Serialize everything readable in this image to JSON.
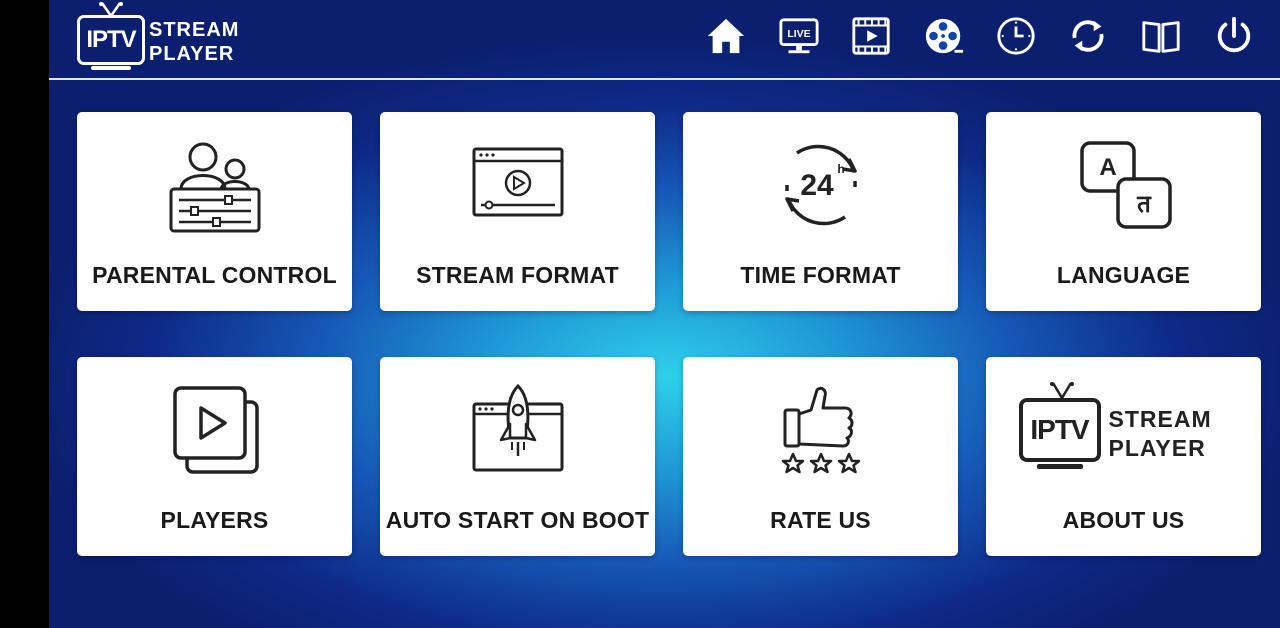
{
  "app": {
    "logo_badge": "IPTV",
    "logo_line1": "STREAM",
    "logo_line2": "PLAYER"
  },
  "nav": [
    {
      "icon": "home-icon"
    },
    {
      "icon": "live-tv-icon",
      "badge": "LIVE"
    },
    {
      "icon": "movies-icon"
    },
    {
      "icon": "film-reel-icon"
    },
    {
      "icon": "clock-icon"
    },
    {
      "icon": "refresh-icon"
    },
    {
      "icon": "book-icon"
    },
    {
      "icon": "power-icon"
    }
  ],
  "tiles": {
    "parental_control": {
      "label": "PARENTAL CONTROL",
      "icon": "parental-control-icon"
    },
    "stream_format": {
      "label": "STREAM FORMAT",
      "icon": "stream-format-icon"
    },
    "time_format": {
      "label": "TIME FORMAT",
      "icon": "time-format-icon",
      "icon_text": "24",
      "icon_sup": "h"
    },
    "language": {
      "label": "LANGUAGE",
      "icon": "language-icon",
      "glyph_a": "A",
      "glyph_b": "त"
    },
    "players": {
      "label": "PLAYERS",
      "icon": "players-icon"
    },
    "auto_start": {
      "label": "AUTO START ON BOOT",
      "icon": "rocket-icon"
    },
    "rate_us": {
      "label": "RATE US",
      "icon": "thumbs-up-icon"
    },
    "about_us": {
      "label": "ABOUT US",
      "icon": "app-logo-icon",
      "logo_badge": "IPTV",
      "logo_line1": "STREAM",
      "logo_line2": "PLAYER"
    }
  },
  "colors": {
    "background_center": "#2fd0ea",
    "background_edge": "#0b1f6e",
    "tile_bg": "#ffffff",
    "label_text": "#1a1a1a",
    "icon_white": "#ffffff"
  }
}
